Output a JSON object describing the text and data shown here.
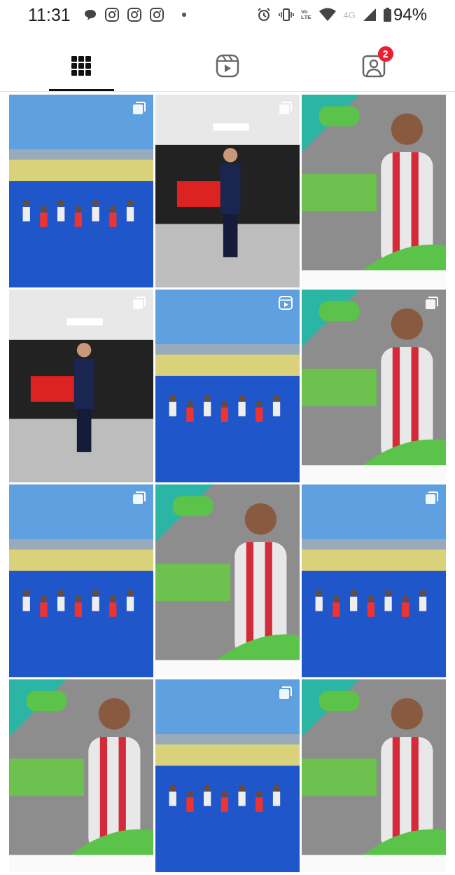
{
  "status_bar": {
    "time": "11:31",
    "network_label": "4G",
    "volte_top": "Vo",
    "volte_bottom": "LTE",
    "battery": "94%"
  },
  "tabs": [
    {
      "kind": "grid",
      "selected": true
    },
    {
      "kind": "reels",
      "selected": false
    },
    {
      "kind": "tagged",
      "selected": false,
      "badge": "2"
    }
  ],
  "posts": [
    {
      "kind": "picture",
      "multiple": true,
      "video": false
    },
    {
      "kind": "picture",
      "multiple": true,
      "video": false
    },
    {
      "kind": "picture",
      "multiple": false,
      "video": false
    },
    {
      "kind": "picture",
      "multiple": true,
      "video": false
    },
    {
      "kind": "picture",
      "multiple": false,
      "video": true
    },
    {
      "kind": "picture",
      "multiple": true,
      "video": false
    },
    {
      "kind": "picture",
      "multiple": true,
      "video": false
    },
    {
      "kind": "picture",
      "multiple": false,
      "video": false
    },
    {
      "kind": "picture",
      "multiple": true,
      "video": false
    },
    {
      "kind": "picture",
      "multiple": false,
      "video": false
    },
    {
      "kind": "picture",
      "multiple": true,
      "video": false
    },
    {
      "kind": "picture",
      "multiple": false,
      "video": false
    }
  ]
}
